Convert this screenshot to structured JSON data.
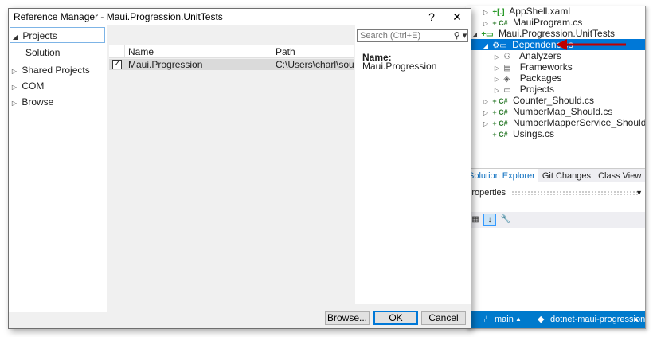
{
  "dialog": {
    "title": "Reference Manager - Maui.Progression.UnitTests",
    "help_label": "?",
    "close_label": "✕",
    "nav": [
      {
        "label": "Projects",
        "arrow": "◢"
      },
      {
        "label": "Solution",
        "arrow": ""
      },
      {
        "label": "Shared Projects",
        "arrow": "▷"
      },
      {
        "label": "COM",
        "arrow": "▷"
      },
      {
        "label": "Browse",
        "arrow": "▷"
      }
    ],
    "search": {
      "placeholder": "Search (Ctrl+E)",
      "value": ""
    },
    "columns": [
      "Name",
      "Path"
    ],
    "rows": [
      {
        "checked": true,
        "check_glyph": "✓",
        "name": "Maui.Progression",
        "path": "C:\\Users\\charl\\source..."
      }
    ],
    "details": {
      "name_label": "Name:",
      "name_value": "Maui.Progression"
    },
    "buttons": {
      "browse": "Browse...",
      "ok": "OK",
      "cancel": "Cancel"
    }
  },
  "solution_explorer": {
    "tree": [
      {
        "arrow": "▷",
        "icon": "+[.]",
        "label": "AppShell.xaml"
      },
      {
        "arrow": "▷",
        "icon": "+ C#",
        "label": "MauiProgram.cs"
      },
      {
        "arrow": "◢",
        "icon": "+▭",
        "label": "Maui.Progression.UnitTests"
      },
      {
        "arrow": "◢",
        "icon": "⚙▭",
        "label": "Dependencies"
      },
      {
        "arrow": "▷",
        "icon": "⚇",
        "label": "Analyzers"
      },
      {
        "arrow": "▷",
        "icon": "▤",
        "label": "Frameworks"
      },
      {
        "arrow": "▷",
        "icon": "◈",
        "label": "Packages"
      },
      {
        "arrow": "▷",
        "icon": "▭",
        "label": "Projects"
      },
      {
        "arrow": "▷",
        "icon": "+ C#",
        "label": "Counter_Should.cs"
      },
      {
        "arrow": "▷",
        "icon": "+ C#",
        "label": "NumberMap_Should.cs"
      },
      {
        "arrow": "▷",
        "icon": "+ C#",
        "label": "NumberMapperService_Should.cs"
      },
      {
        "arrow": "",
        "icon": "+ C#",
        "label": "Usings.cs"
      }
    ],
    "tabs": [
      "Solution Explorer",
      "Git Changes",
      "Class View"
    ],
    "properties_label": "Properties",
    "status": {
      "branch_icon": "⑂",
      "branch": "main",
      "repo_icon": "◆",
      "repo": "dotnet-maui-progression",
      "caret": "▲"
    }
  },
  "colors": {
    "accent": "#0078d7",
    "status_bar": "#007acc",
    "annotation_arrow": "#c00000"
  }
}
